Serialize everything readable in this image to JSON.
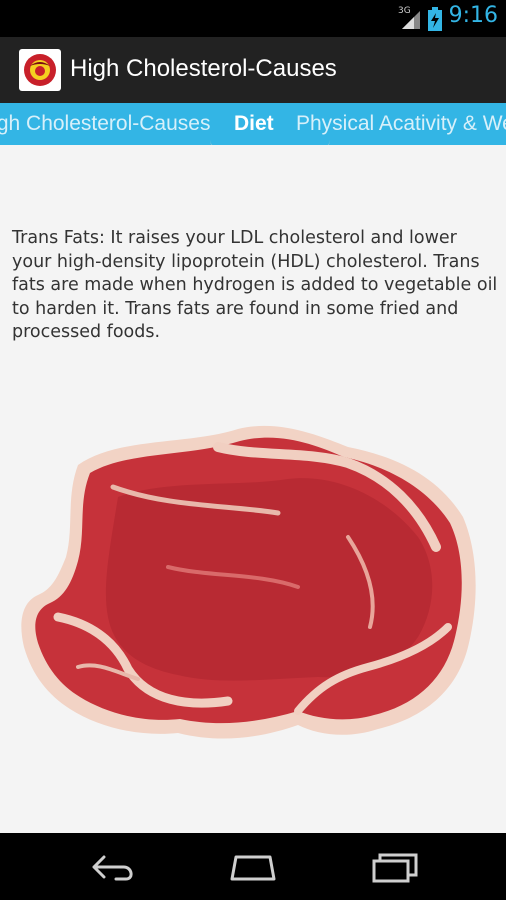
{
  "status_bar": {
    "network": "3G",
    "time": "9:16"
  },
  "action_bar": {
    "title": "High Cholesterol-Causes"
  },
  "tabs": [
    {
      "label": "High Cholesterol-Causes"
    },
    {
      "label": "Diet"
    },
    {
      "label": "Physical Acativity & Weight"
    }
  ],
  "content": {
    "text": "Trans Fats: It raises your LDL cholesterol and lower your high-density lipoprotein (HDL) cholesterol. Trans fats are made when hydrogen is added to vegetable oil to harden it. Trans fats are found in some fried and processed foods."
  },
  "colors": {
    "accent": "#33b5e5",
    "action_bar": "#222222",
    "content_bg": "#f4f4f4"
  },
  "icons": {
    "back": "back-icon",
    "home": "home-icon",
    "recents": "recents-icon"
  }
}
